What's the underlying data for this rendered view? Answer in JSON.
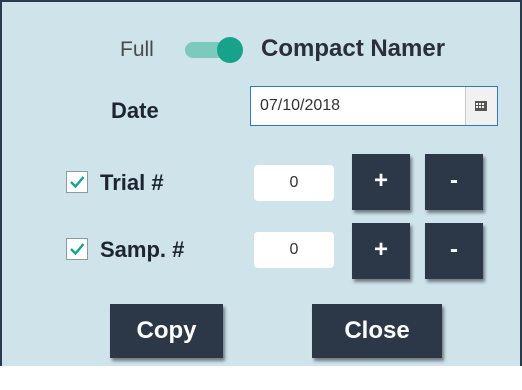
{
  "header": {
    "full_label": "Full",
    "mode_label": "Compact Namer",
    "toggle_on": true
  },
  "date": {
    "label": "Date",
    "value": "07/10/2018",
    "calendar_icon": "calendar-icon"
  },
  "trial": {
    "checked": true,
    "label": "Trial #",
    "value": "0",
    "plus_label": "+",
    "minus_label": "-"
  },
  "samp": {
    "checked": true,
    "label": "Samp. #",
    "value": "0",
    "plus_label": "+",
    "minus_label": "-"
  },
  "actions": {
    "copy_label": "Copy",
    "close_label": "Close"
  },
  "colors": {
    "panel_bg": "#cfe3eb",
    "button_bg": "#2c3848",
    "accent": "#16a38a"
  }
}
